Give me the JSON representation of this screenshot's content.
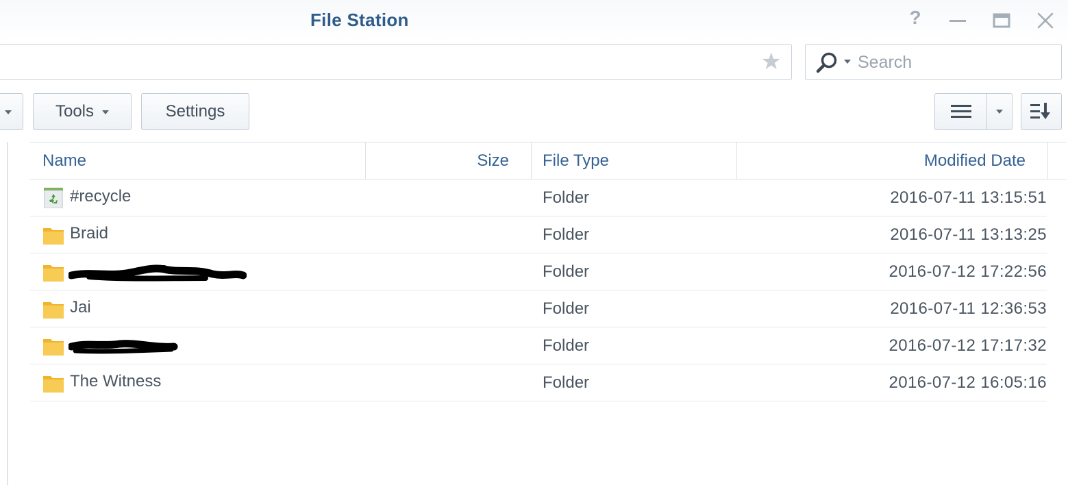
{
  "window": {
    "title": "File Station"
  },
  "address_bar": {
    "path": ""
  },
  "search": {
    "placeholder": "Search"
  },
  "toolbar": {
    "tools_label": "Tools",
    "settings_label": "Settings"
  },
  "columns": {
    "name": "Name",
    "size": "Size",
    "file_type": "File Type",
    "modified_date": "Modified Date"
  },
  "rows": [
    {
      "name": "#recycle",
      "size": "",
      "type": "Folder",
      "modified": "2016-07-11 13:15:51",
      "icon": "recycle-bin-icon",
      "redacted": false
    },
    {
      "name": "Braid",
      "size": "",
      "type": "Folder",
      "modified": "2016-07-11 13:13:25",
      "icon": "folder-icon",
      "redacted": false
    },
    {
      "name": "",
      "size": "",
      "type": "Folder",
      "modified": "2016-07-12 17:22:56",
      "icon": "folder-icon",
      "redacted": true
    },
    {
      "name": "Jai",
      "size": "",
      "type": "Folder",
      "modified": "2016-07-11 12:36:53",
      "icon": "folder-icon",
      "redacted": false
    },
    {
      "name": "",
      "size": "",
      "type": "Folder",
      "modified": "2016-07-12 17:17:32",
      "icon": "folder-icon",
      "redacted": true
    },
    {
      "name": "The Witness",
      "size": "",
      "type": "Folder",
      "modified": "2016-07-12 16:05:16",
      "icon": "folder-icon",
      "redacted": false
    }
  ],
  "icons": {
    "help": "help-icon",
    "minimize": "minimize-icon",
    "maximize": "maximize-icon",
    "close": "close-icon",
    "favorite": "star-icon",
    "search": "search-icon",
    "list_view": "list-view-icon",
    "sort": "sort-icon"
  },
  "colors": {
    "title": "#2f5c8a",
    "header_text": "#356294",
    "folder": "#f5c04a"
  }
}
